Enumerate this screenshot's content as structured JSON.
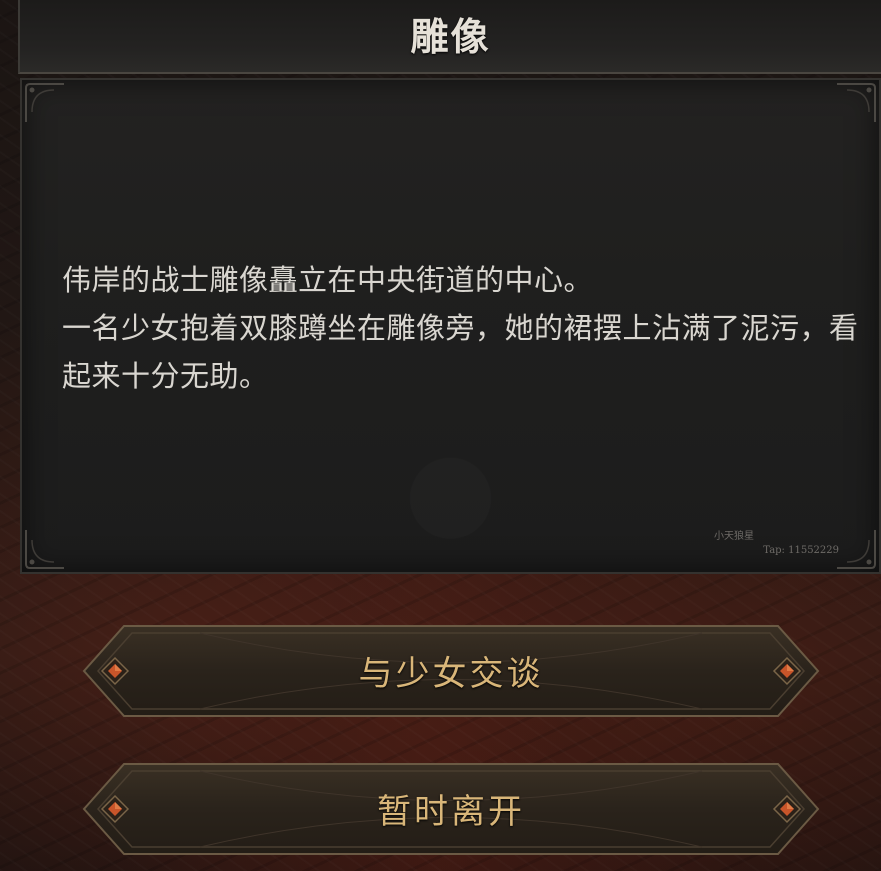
{
  "title": "雕像",
  "description": {
    "lines": [
      "伟岸的战士雕像矗立在中央街道的中心。",
      "一名少女抱着双膝蹲坐在雕像旁，她的裙摆上沾满了泥污，看起来十分无助。"
    ]
  },
  "watermark": {
    "name": "小天狼星",
    "tap_id": "Tap: 11552229"
  },
  "choices": [
    {
      "label": "与少女交谈"
    },
    {
      "label": "暂时离开"
    }
  ],
  "colors": {
    "choice_text": "#d9b679",
    "gem": "#c8552a",
    "panel_bg": "#1f1f1e",
    "title_text": "#e6e1d8"
  },
  "icons": {
    "gem_left": "diamond-gem-icon",
    "gem_right": "diamond-gem-icon",
    "corner": "ornate-corner-icon"
  }
}
